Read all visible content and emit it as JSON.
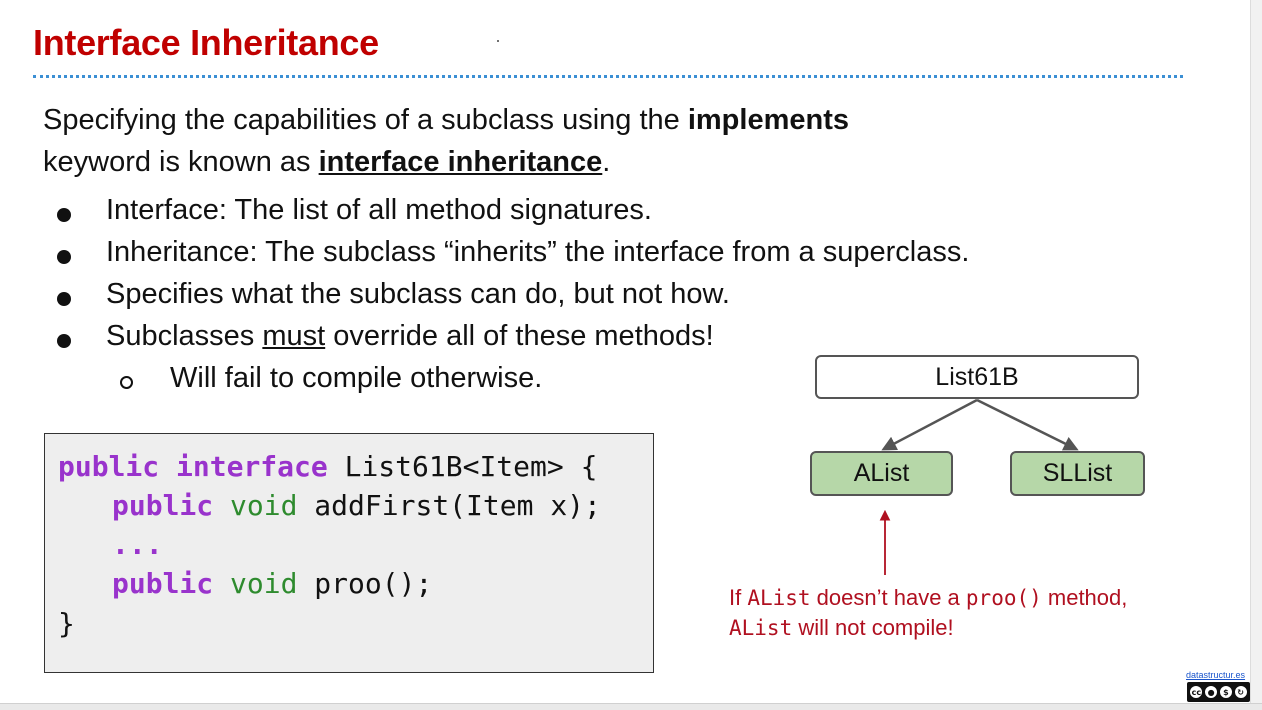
{
  "slide": {
    "title": "Interface Inheritance",
    "intro": {
      "line1_pre": "Specifying the capabilities of a subclass using the ",
      "line1_bold": "implements",
      "line2_pre": "keyword is known as ",
      "line2_term": "interface inheritance",
      "line2_post": "."
    },
    "bullets": [
      {
        "text": "Interface: The list of all method signatures."
      },
      {
        "text": "Inheritance: The subclass “inherits” the interface from a superclass."
      },
      {
        "text": "Specifies what the subclass can do, but not how."
      },
      {
        "pre": "Subclasses ",
        "underlined": "must",
        "post": " override all of these methods!"
      }
    ],
    "sub_bullets": [
      {
        "text": "Will fail to compile otherwise."
      }
    ]
  },
  "code": {
    "line1": {
      "kw1": "public",
      "kw2": "interface",
      "rest": " List61B<Item> {"
    },
    "line2": {
      "kw": "public",
      "ty": "void",
      "rest": " addFirst(Item x);"
    },
    "line3": {
      "text": "..."
    },
    "line4": {
      "kw": "public",
      "ty": "void",
      "rest": " proo();"
    },
    "line5": {
      "text": "}"
    }
  },
  "diagram": {
    "root": "List61B",
    "children": [
      "AList",
      "SLList"
    ]
  },
  "note": {
    "p1": "If ",
    "code1": "AList",
    "p2": " doesn’t have a ",
    "code2": "proo()",
    "p3": " method,",
    "code3": "AList",
    "p4": " will not compile!"
  },
  "footer": {
    "link": "datastructur.es",
    "license_icons": [
      "cc-icon",
      "by-icon",
      "nc-icon",
      "sa-icon"
    ]
  },
  "colors": {
    "title": "#c00000",
    "keyword": "#9933cc",
    "type": "#2e8b2e",
    "note": "#b01020",
    "node_fill": "#b6d7a8"
  }
}
